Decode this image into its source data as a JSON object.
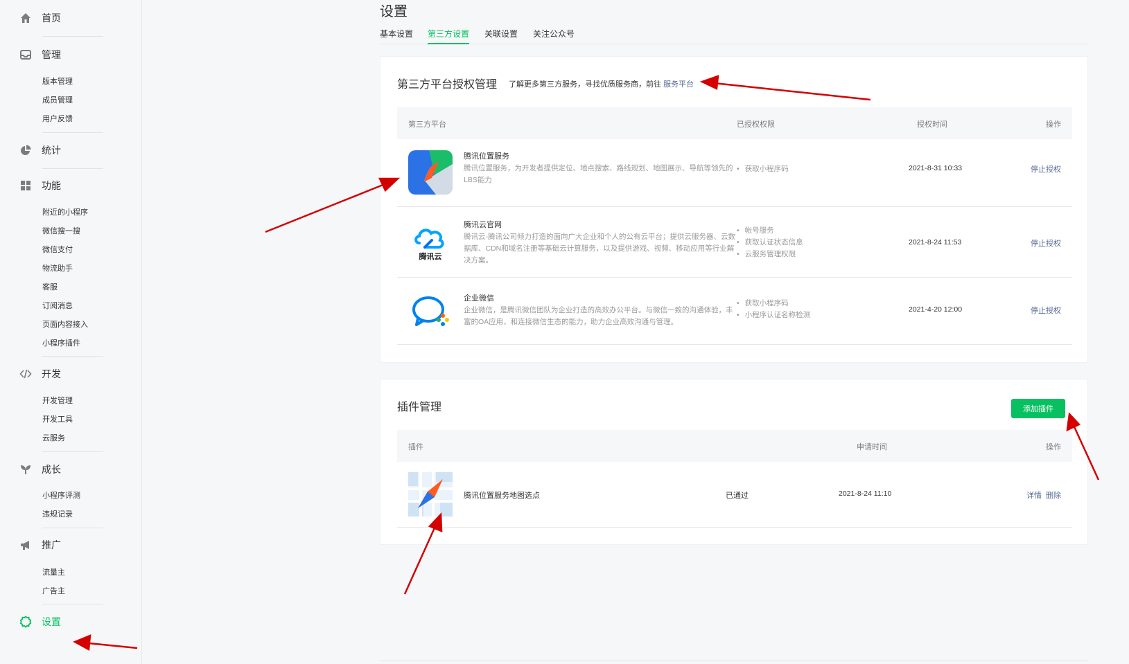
{
  "sidebar": {
    "home": "首页",
    "manage": {
      "label": "管理",
      "items": [
        "版本管理",
        "成员管理",
        "用户反馈"
      ]
    },
    "stats": "统计",
    "features": {
      "label": "功能",
      "items": [
        "附近的小程序",
        "微信搜一搜",
        "微信支付",
        "物流助手",
        "客服",
        "订阅消息",
        "页面内容接入",
        "小程序插件"
      ]
    },
    "dev": {
      "label": "开发",
      "items": [
        "开发管理",
        "开发工具",
        "云服务"
      ]
    },
    "growth": {
      "label": "成长",
      "items": [
        "小程序评测",
        "违规记录"
      ]
    },
    "promo": {
      "label": "推广",
      "items": [
        "流量主",
        "广告主"
      ]
    },
    "settings": "设置",
    "active_color": "#07c160"
  },
  "page": {
    "title": "设置",
    "tabs": [
      "基本设置",
      "第三方设置",
      "关联设置",
      "关注公众号"
    ],
    "active_tab": 1
  },
  "third_party": {
    "title": "第三方平台授权管理",
    "hint": "了解更多第三方服务，寻找优质服务商，前往 ",
    "hint_link": "服务平台",
    "columns": [
      "第三方平台",
      "已授权权限",
      "授权时间",
      "操作"
    ],
    "rows": [
      {
        "name": "腾讯位置服务",
        "desc": "腾讯位置服务，为开发者提供定位、地点搜索、路线规划、地图展示、导航等领先的LBS能力",
        "perms": [
          "获取小程序码"
        ],
        "time": "2021-8-31 10:33",
        "op": "停止授权",
        "icon": "tencent-location-icon"
      },
      {
        "name": "腾讯云官网",
        "desc": "腾讯云-腾讯公司倾力打造的面向广大企业和个人的公有云平台；提供云服务器、云数据库、CDN和域名注册等基础云计算服务，以及提供游戏、视频、移动应用等行业解决方案。",
        "perms": [
          "帐号服务",
          "获取认证状态信息",
          "云服务管理权限"
        ],
        "time": "2021-8-24 11:53",
        "op": "停止授权",
        "icon": "tencent-cloud-icon",
        "logo_text": "腾讯云"
      },
      {
        "name": "企业微信",
        "desc": "企业微信，是腾讯微信团队为企业打造的高效办公平台。与微信一致的沟通体验，丰富的OA应用，和连接微信生态的能力，助力企业高效沟通与管理。",
        "perms": [
          "获取小程序码",
          "小程序认证名称检测"
        ],
        "time": "2021-4-20 12:00",
        "op": "停止授权",
        "icon": "wecom-icon"
      }
    ]
  },
  "plugins": {
    "title": "插件管理",
    "add_button": "添加插件",
    "columns": [
      "插件",
      "申请时间",
      "操作"
    ],
    "rows": [
      {
        "name": "腾讯位置服务地图选点",
        "status": "已通过",
        "time": "2021-8-24 11:10",
        "op_detail": "详情",
        "op_delete": "删除",
        "icon": "map-picker-icon"
      }
    ]
  },
  "annotation_color": "#d40000"
}
